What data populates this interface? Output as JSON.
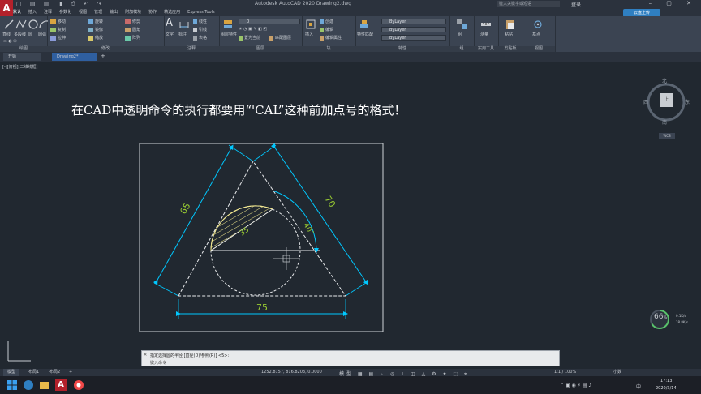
{
  "app": {
    "title": "Autodesk AutoCAD 2020   Drawing2.dwg",
    "search_placeholder": "键入关键字或短语",
    "user": "登录",
    "cloud_button": "云盘上传",
    "window_controls": "– ▢ ✕"
  },
  "menu": [
    "默认",
    "插入",
    "注释",
    "参数化",
    "视图",
    "管理",
    "输出",
    "附加模块",
    "协作",
    "精选应用",
    "Express Tools"
  ],
  "ribbon": {
    "panels": [
      "绘图",
      "修改",
      "注释",
      "图层",
      "块",
      "特性",
      "组",
      "实用工具",
      "剪贴板",
      "视图"
    ],
    "draw_tools": [
      "直线",
      "多段线",
      "圆",
      "圆弧"
    ],
    "modify_tools": [
      "移动",
      "旋转",
      "修剪",
      "复制",
      "镜像",
      "圆角",
      "拉伸",
      "缩放",
      "阵列"
    ],
    "annotation_tools": [
      "文字",
      "标注",
      "线性",
      "引线",
      "表格"
    ],
    "layer_tools": [
      "图层特性",
      "置为当前",
      "匹配图层"
    ],
    "block_tools": [
      "插入",
      "创建",
      "编辑",
      "编辑属性"
    ],
    "property_tools": [
      "特性匹配"
    ],
    "group_tools": [
      "组"
    ],
    "utility_tools": [
      "测量"
    ],
    "clipboard_tools": [
      "粘贴"
    ],
    "view_tools": [
      "基点"
    ],
    "layer_value": "0",
    "bylayer_color": "ByLayer",
    "bylayer_linetype": "ByLayer",
    "bylayer_lineweight": "ByLayer"
  },
  "doc_tabs": [
    "开始",
    "Drawing2*"
  ],
  "viewport_label": "[-][俯视][二维线框]",
  "headline": "在CAD中透明命令的执行都要用“'CAL”这种前加点号的格式！",
  "viewcube": {
    "north": "北",
    "south": "南",
    "east": "东",
    "west": "西",
    "top": "上",
    "wcs": "WCS"
  },
  "gauge": {
    "value": "66",
    "unit": "%",
    "net_up": "0.1K/s",
    "net_down": "18.8K/s"
  },
  "drawing": {
    "dim_left": "65",
    "dim_right": "70",
    "dim_bottom": "75",
    "dim_angle": "40°",
    "dim_inner": "35",
    "colors": {
      "dimension": "#00c8ff",
      "dim_text": "#9acd32",
      "lines": "#ffffff",
      "hatch": "#f0e68c"
    }
  },
  "command": {
    "history": "指定选择圆的半径 [直径(D)/参照(R)] <5>:",
    "input": "键入命令"
  },
  "layout_tabs": [
    "模型",
    "布局1",
    "布局2"
  ],
  "status": {
    "coords": "1252.8157, 816.8203, 0.0000",
    "mode": "模型",
    "zoom": "1:1 / 100%",
    "ui": "小数"
  },
  "taskbar": {
    "time": "17:13",
    "date": "2020/3/14",
    "lang": "中"
  }
}
